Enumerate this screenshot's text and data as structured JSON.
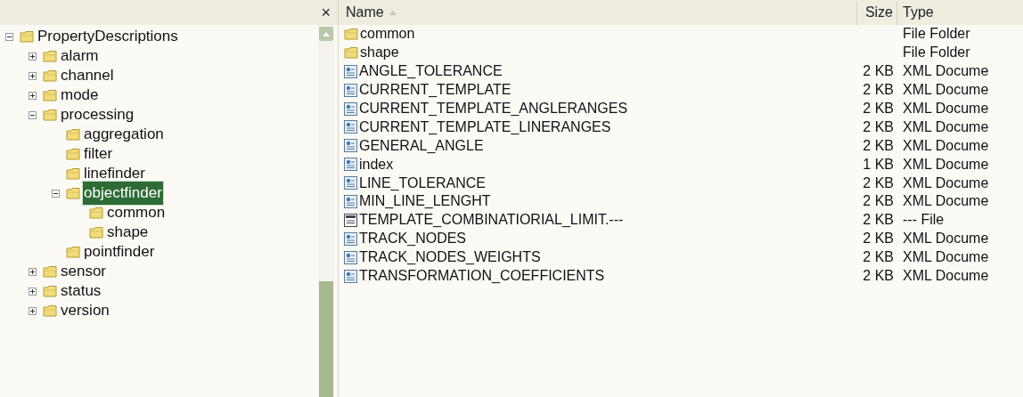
{
  "folders_pane": {
    "close": "×",
    "tree": [
      {
        "label": "PropertyDescriptions",
        "expanded": true,
        "selected": false,
        "children": [
          {
            "label": "alarm",
            "expanded": false,
            "selected": false
          },
          {
            "label": "channel",
            "expanded": false,
            "selected": false
          },
          {
            "label": "mode",
            "expanded": false,
            "selected": false
          },
          {
            "label": "processing",
            "expanded": true,
            "selected": false,
            "children": [
              {
                "label": "aggregation",
                "selected": false
              },
              {
                "label": "filter",
                "selected": false
              },
              {
                "label": "linefinder",
                "selected": false
              },
              {
                "label": "objectfinder",
                "expanded": true,
                "selected": true,
                "children": [
                  {
                    "label": "common",
                    "selected": false
                  },
                  {
                    "label": "shape",
                    "selected": false
                  }
                ]
              },
              {
                "label": "pointfinder",
                "selected": false
              }
            ]
          },
          {
            "label": "sensor",
            "expanded": false,
            "selected": false
          },
          {
            "label": "status",
            "expanded": false,
            "selected": false
          },
          {
            "label": "version",
            "expanded": false,
            "selected": false
          }
        ]
      }
    ]
  },
  "file_list": {
    "columns": [
      "Name",
      "Size",
      "Type"
    ],
    "rows": [
      {
        "name": "common",
        "type": "File Folder",
        "kind": "folder"
      },
      {
        "name": "shape",
        "type": "File Folder",
        "kind": "folder"
      },
      {
        "name": "ANGLE_TOLERANCE",
        "size": "2 KB",
        "type": "XML Docume",
        "kind": "xml"
      },
      {
        "name": "CURRENT_TEMPLATE",
        "size": "2 KB",
        "type": "XML Docume",
        "kind": "xml"
      },
      {
        "name": "CURRENT_TEMPLATE_ANGLERANGES",
        "size": "2 KB",
        "type": "XML Docume",
        "kind": "xml"
      },
      {
        "name": "CURRENT_TEMPLATE_LINERANGES",
        "size": "2 KB",
        "type": "XML Docume",
        "kind": "xml"
      },
      {
        "name": "GENERAL_ANGLE",
        "size": "2 KB",
        "type": "XML Docume",
        "kind": "xml"
      },
      {
        "name": "index",
        "size": "1 KB",
        "type": "XML Docume",
        "kind": "xml"
      },
      {
        "name": "LINE_TOLERANCE",
        "size": "2 KB",
        "type": "XML Docume",
        "kind": "xml"
      },
      {
        "name": "MIN_LINE_LENGHT",
        "size": "2 KB",
        "type": "XML Docume",
        "kind": "xml"
      },
      {
        "name": "TEMPLATE_COMBINATIORIAL_LIMIT.---",
        "size": "2 KB",
        "type": "--- File",
        "kind": "file"
      },
      {
        "name": "TRACK_NODES",
        "size": "2 KB",
        "type": "XML Docume",
        "kind": "xml"
      },
      {
        "name": "TRACK_NODES_WEIGHTS",
        "size": "2 KB",
        "type": "XML Docume",
        "kind": "xml"
      },
      {
        "name": "TRANSFORMATION_COEFFICIENTS",
        "size": "2 KB",
        "type": "XML Docume",
        "kind": "xml"
      }
    ]
  }
}
